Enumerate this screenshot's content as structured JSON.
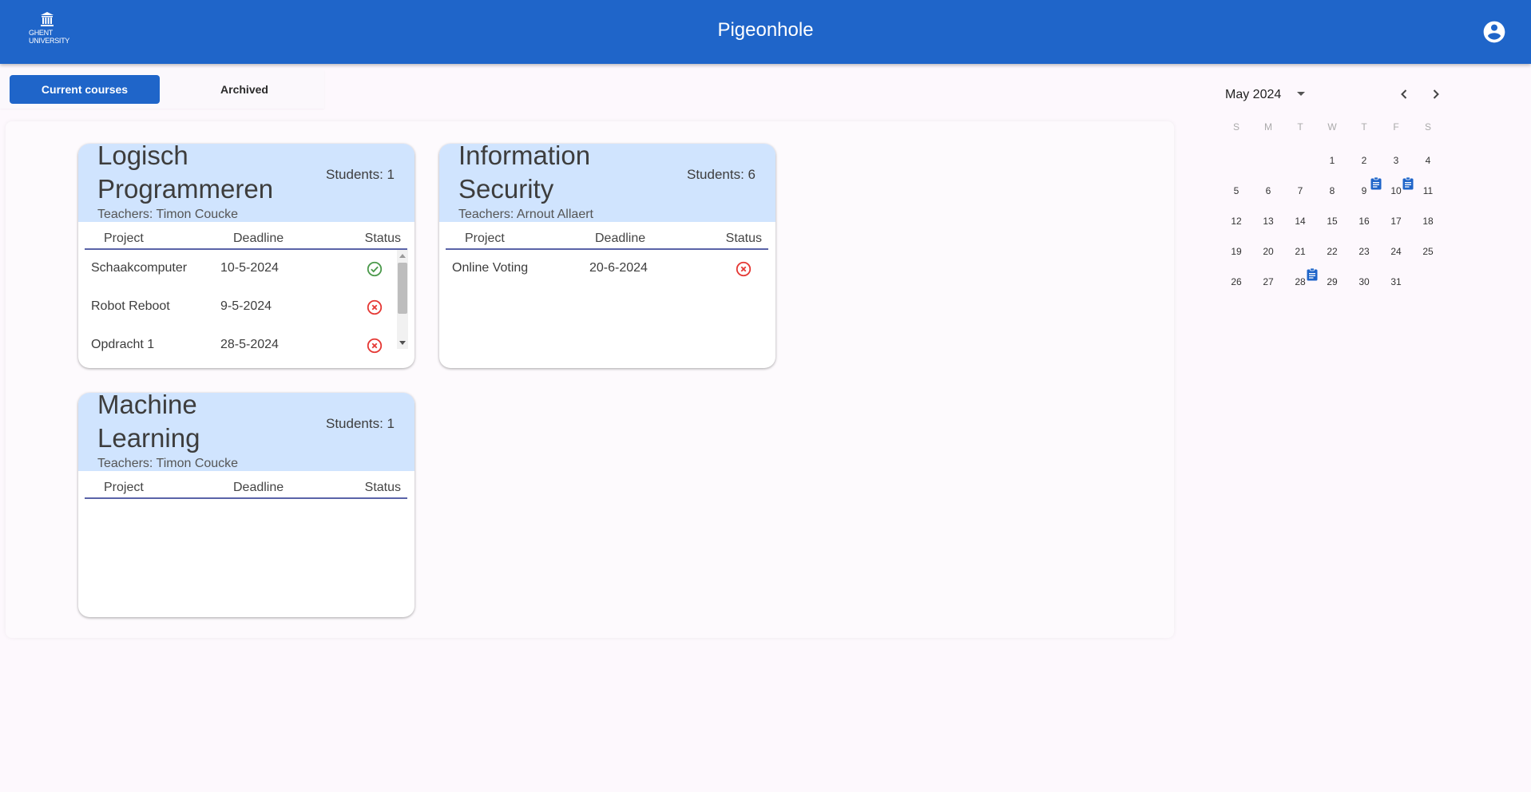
{
  "header": {
    "logo_text": "GHENT\nUNIVERSITY",
    "title": "Pigeonhole",
    "account_icon": "account-circle-icon"
  },
  "tabs": [
    {
      "label": "Current courses",
      "active": true
    },
    {
      "label": "Archived",
      "active": false
    }
  ],
  "courses": [
    {
      "name": "Logisch Programmeren",
      "students": "Students: 1",
      "teachers": "Teachers: Timon Coucke",
      "columns": {
        "project": "Project",
        "deadline": "Deadline",
        "status": "Status"
      },
      "projects": [
        {
          "name": "Schaakcomputer",
          "deadline": "10-5-2024",
          "status": "success"
        },
        {
          "name": "Robot Reboot",
          "deadline": "9-5-2024",
          "status": "failed"
        },
        {
          "name": "Opdracht 1",
          "deadline": "28-5-2024",
          "status": "failed"
        }
      ]
    },
    {
      "name": "Information Security",
      "students": "Students: 6",
      "teachers": "Teachers: Arnout Allaert",
      "columns": {
        "project": "Project",
        "deadline": "Deadline",
        "status": "Status"
      },
      "projects": [
        {
          "name": "Online Voting",
          "deadline": "20-6-2024",
          "status": "failed"
        }
      ]
    },
    {
      "name": "Machine Learning",
      "students": "Students: 1",
      "teachers": "Teachers: Timon Coucke",
      "columns": {
        "project": "Project",
        "deadline": "Deadline",
        "status": "Status"
      },
      "projects": []
    }
  ],
  "status_icons": {
    "success": "check-circle-icon",
    "failed": "cancel-circle-icon"
  },
  "status_colors": {
    "success": "#4c9a4c",
    "failed": "#e53935"
  },
  "calendar": {
    "month_label": "May 2024",
    "weekdays": [
      "S",
      "M",
      "T",
      "W",
      "T",
      "F",
      "S"
    ],
    "first_weekday": 3,
    "days": 31,
    "deadline_days": [
      9,
      10,
      28
    ],
    "deadline_icon": "assignment-icon"
  },
  "colors": {
    "primary": "#1f65c9",
    "card_header": "#d0e4fe",
    "divider": "#5a63a8"
  }
}
